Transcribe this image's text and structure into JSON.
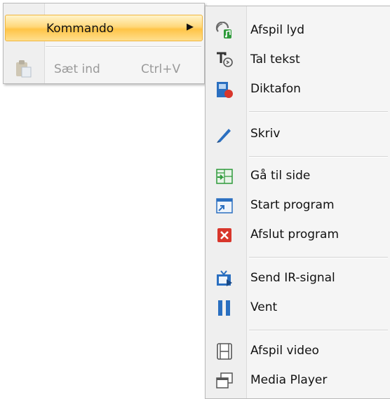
{
  "menu_main": {
    "items": [
      {
        "label": "Kommando",
        "arrow": "▶",
        "icon": "none",
        "highlighted": true
      },
      {
        "label": "Sæt ind",
        "shortcut": "Ctrl+V",
        "icon": "paste-icon",
        "disabled": true
      }
    ]
  },
  "submenu": {
    "items": [
      {
        "label": "Afspil lyd",
        "icon": "play-sound-icon"
      },
      {
        "label": "Tal tekst",
        "icon": "speak-text-icon"
      },
      {
        "label": "Diktafon",
        "icon": "dictaphone-icon"
      },
      {
        "label": "Skriv",
        "icon": "pen-icon"
      },
      {
        "label": "Gå til side",
        "icon": "goto-page-icon"
      },
      {
        "label": "Start program",
        "icon": "start-program-icon"
      },
      {
        "label": "Afslut program",
        "icon": "close-program-icon"
      },
      {
        "label": "Send IR-signal",
        "icon": "ir-signal-icon"
      },
      {
        "label": "Vent",
        "icon": "pause-icon"
      },
      {
        "label": "Afspil video",
        "icon": "film-icon"
      },
      {
        "label": "Media Player",
        "icon": "media-player-icon"
      }
    ]
  },
  "colors": {
    "highlight": "#ffc447",
    "blue": "#2a6fc0",
    "red": "#d8362b",
    "green": "#2e9a3a"
  }
}
